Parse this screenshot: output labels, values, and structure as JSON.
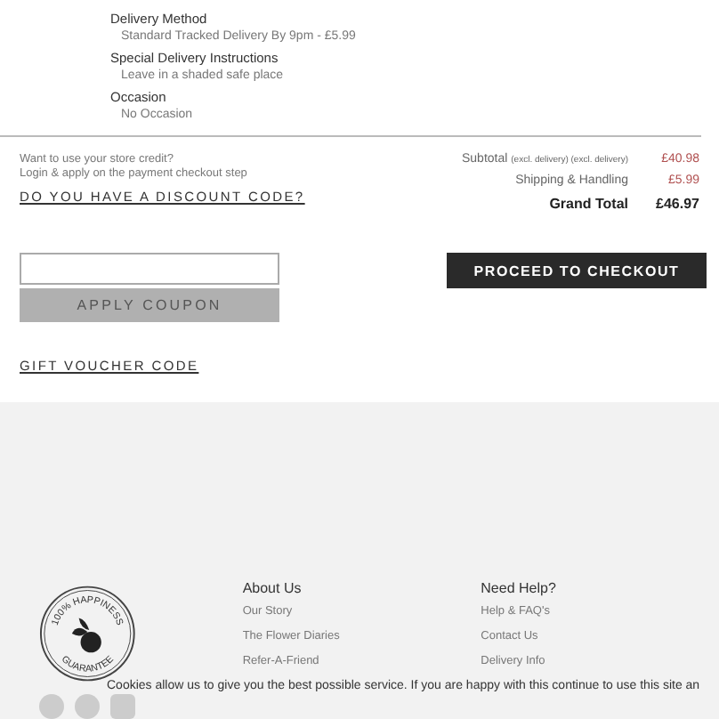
{
  "order_details": [
    {
      "label": "Delivery Method",
      "value": "Standard Tracked Delivery By 9pm - £5.99"
    },
    {
      "label": "Special Delivery Instructions",
      "value": "Leave in a shaded safe place"
    },
    {
      "label": "Occasion",
      "value": "No Occasion"
    }
  ],
  "store_credit": {
    "line_1": "Want to use your store credit?",
    "line_2": "Login & apply on the payment checkout step"
  },
  "discount_link": "DO YOU HAVE A DISCOUNT CODE?",
  "coupon": {
    "button": "APPLY COUPON"
  },
  "gift_voucher_link": "GIFT VOUCHER CODE",
  "totals": [
    {
      "kind": "minor",
      "label": "Subtotal",
      "note": "(excl. delivery) (excl. delivery)",
      "value": "£40.98"
    },
    {
      "kind": "minor",
      "label": "Shipping & Handling",
      "value": "£5.99"
    },
    {
      "kind": "grand",
      "label": "Grand Total",
      "value": "£46.97"
    }
  ],
  "checkout_button": "PROCEED TO CHECKOUT",
  "footer": {
    "badge_top": "100% HAPPINESS",
    "badge_bottom": "GUARANTEE",
    "columns": [
      {
        "heading": "About Us",
        "links": [
          "Our Story",
          "The Flower Diaries",
          "Refer-A-Friend"
        ]
      },
      {
        "heading": "Need Help?",
        "links": [
          "Help & FAQ's",
          "Contact Us",
          "Delivery Info"
        ]
      }
    ]
  },
  "cookie_notice": "Cookies allow us to give you the best possible service. If you are happy with this continue to use this site an"
}
